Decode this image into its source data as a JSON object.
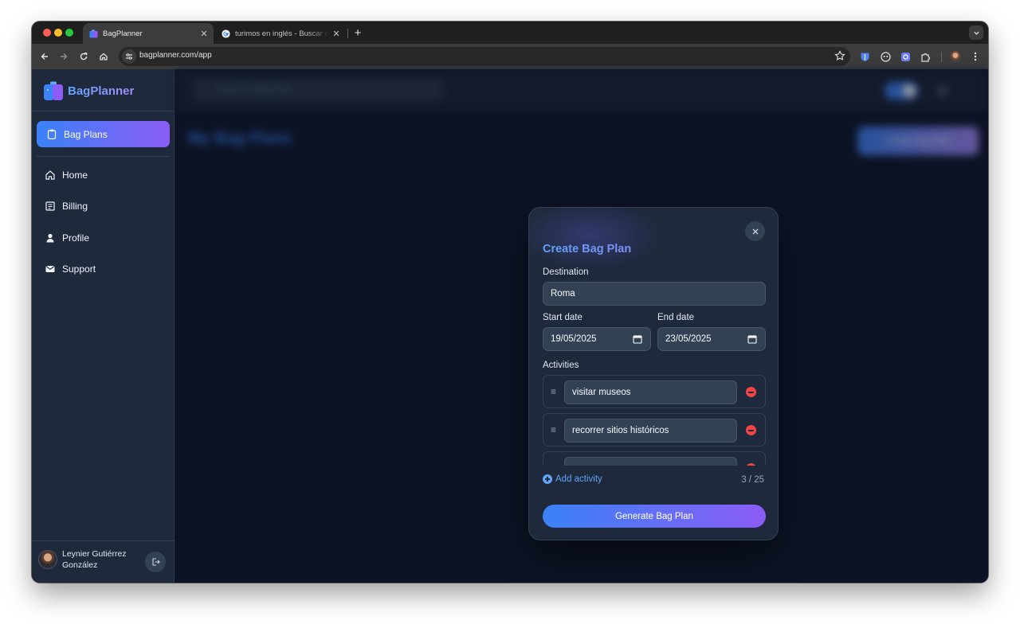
{
  "browser": {
    "tabs": [
      {
        "title": "BagPlanner",
        "active": true,
        "favicon": "bagplanner-logo-icon"
      },
      {
        "title": "turimos en inglés - Buscar con Google",
        "active": false,
        "favicon": "google-icon"
      }
    ],
    "url": "bagplanner.com/app"
  },
  "sidebar": {
    "brand": "BagPlanner",
    "active_item": {
      "label": "Bag Plans",
      "icon": "clipboard-icon"
    },
    "items": [
      {
        "label": "Home",
        "icon": "home-icon"
      },
      {
        "label": "Billing",
        "icon": "receipt-icon"
      },
      {
        "label": "Profile",
        "icon": "user-icon"
      },
      {
        "label": "Support",
        "icon": "mail-icon"
      }
    ],
    "user": {
      "name": "Leynier Gutiérrez González"
    }
  },
  "background": {
    "search_placeholder": "Search for Bag Plans",
    "page_title": "My Bag Plans",
    "create_button": "Create Bag Plan"
  },
  "modal": {
    "title": "Create Bag Plan",
    "destination_label": "Destination",
    "destination_value": "Roma",
    "start_label": "Start date",
    "start_value": "19/05/2025",
    "end_label": "End date",
    "end_value": "23/05/2025",
    "activities_label": "Activities",
    "activities": [
      "visitar museos",
      "recorrer sitios históricos",
      ""
    ],
    "add_activity": "Add activity",
    "count": "3 / 25",
    "generate_button": "Generate Bag Plan"
  },
  "colors": {
    "accent_start": "#3b82f6",
    "accent_end": "#8b5cf6",
    "sidebar_bg": "#1e293b",
    "page_bg": "#0f172a",
    "danger": "#ef4444"
  }
}
